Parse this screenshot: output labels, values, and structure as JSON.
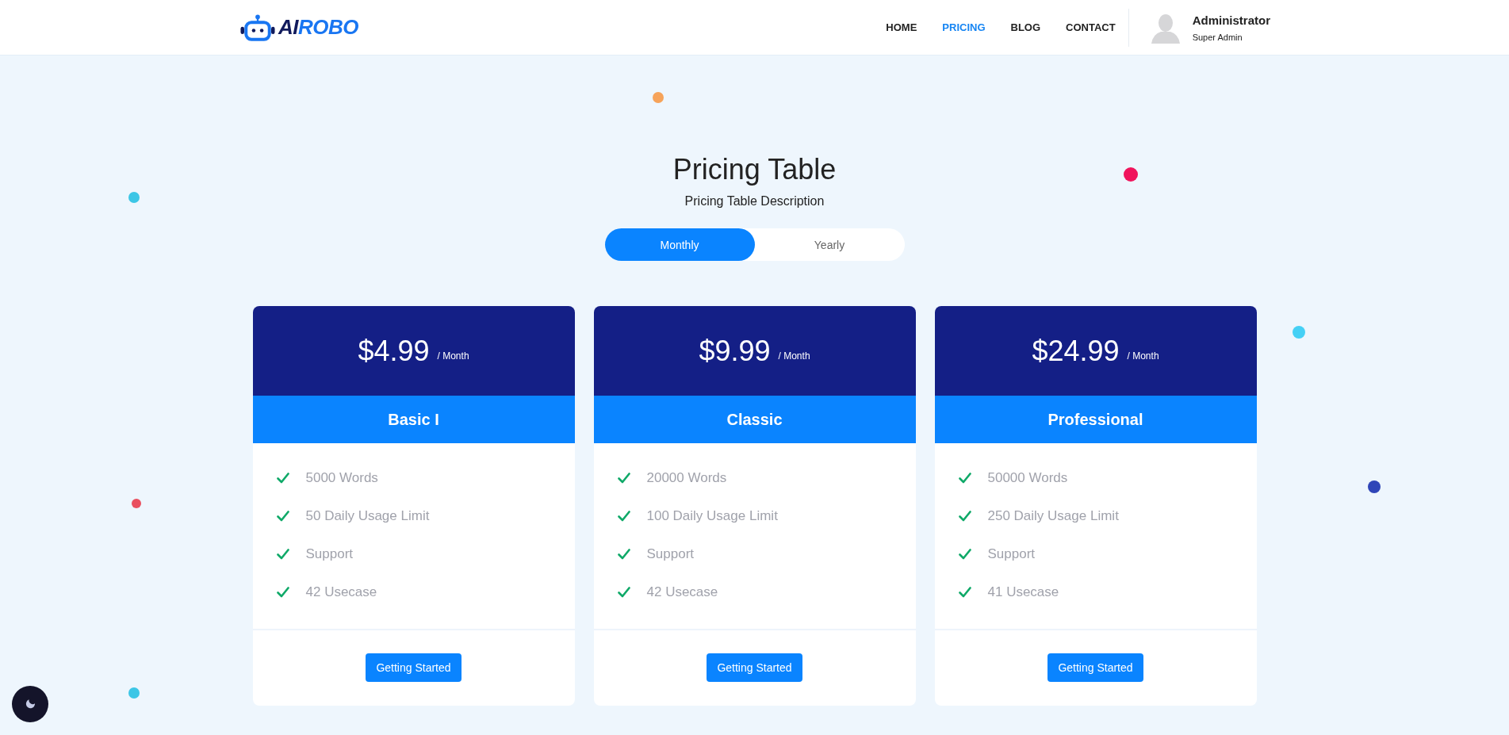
{
  "header": {
    "logo": [
      {
        "text": "AI",
        "color": "#111a5c"
      },
      {
        "text": "ROBO",
        "color": "#1976f2"
      }
    ],
    "nav": [
      {
        "label": "HOME",
        "selected": false
      },
      {
        "label": "PRICING",
        "selected": true
      },
      {
        "label": "BLOG",
        "selected": false
      },
      {
        "label": "CONTACT",
        "selected": false
      }
    ],
    "user": {
      "name": "Administrator",
      "role": "Super Admin"
    }
  },
  "title": "Pricing Table",
  "description": "Pricing Table Description",
  "billing_toggle": [
    {
      "label": "Monthly",
      "selected": true
    },
    {
      "label": "Yearly",
      "selected": false
    }
  ],
  "plans": [
    {
      "price": "$4.99",
      "period": "/ Month",
      "name": "Basic I",
      "features": [
        "5000 Words",
        "50 Daily Usage Limit",
        "Support",
        "42 Usecase"
      ],
      "button": "Getting Started"
    },
    {
      "price": "$9.99",
      "period": "/ Month",
      "name": "Classic",
      "features": [
        "20000 Words",
        "100 Daily Usage Limit",
        "Support",
        "42 Usecase"
      ],
      "button": "Getting Started"
    },
    {
      "price": "$24.99",
      "period": "/ Month",
      "name": "Professional",
      "features": [
        "50000 Words",
        "250 Daily Usage Limit",
        "Support",
        "41 Usecase"
      ],
      "button": "Getting Started"
    }
  ],
  "decor_dots": [
    {
      "color": "#f6a35a"
    },
    {
      "color": "#f0145c"
    },
    {
      "color": "#3cc6e6"
    },
    {
      "color": "#45d0f5"
    },
    {
      "color": "#e9505f"
    },
    {
      "color": "#2f45b8"
    },
    {
      "color": "#3cc6e6"
    }
  ]
}
